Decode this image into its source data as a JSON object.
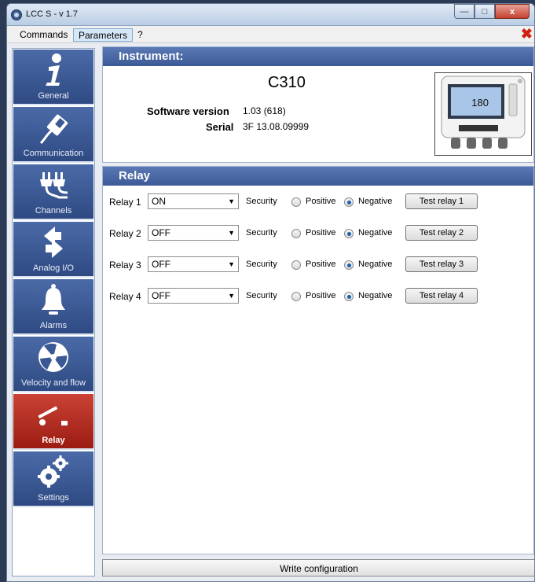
{
  "window": {
    "title": "LCC S - v 1.7",
    "minimize": "—",
    "maximize": "□",
    "close": "x"
  },
  "menubar": {
    "items": [
      "Commands",
      "Parameters",
      "?"
    ],
    "active_item": "Parameters",
    "close_glyph": "✖"
  },
  "sidebar": {
    "items": [
      {
        "label": "General",
        "icon": "info-icon"
      },
      {
        "label": "Communication",
        "icon": "ethernet-cable-icon"
      },
      {
        "label": "Channels",
        "icon": "plug-icon"
      },
      {
        "label": "Analog I/O",
        "icon": "arrows-io-icon"
      },
      {
        "label": "Alarms",
        "icon": "bell-icon"
      },
      {
        "label": "Velocity and flow",
        "icon": "fan-icon"
      },
      {
        "label": "Relay",
        "icon": "switch-icon"
      },
      {
        "label": "Settings",
        "icon": "gears-icon"
      }
    ],
    "selected": "Relay"
  },
  "instrument": {
    "heading": "Instrument:",
    "model": "C310",
    "software_version_label": "Software version",
    "software_version": "1.03 (618)",
    "serial_label": "Serial",
    "serial": "3F 13.08.09999",
    "device_display_value": "180"
  },
  "relay": {
    "heading": "Relay",
    "security_label": "Security",
    "positive_label": "Positive",
    "negative_label": "Negative",
    "rows": [
      {
        "label": "Relay 1",
        "state": "ON",
        "security": "Negative",
        "test_button": "Test relay 1"
      },
      {
        "label": "Relay 2",
        "state": "OFF",
        "security": "Negative",
        "test_button": "Test relay 2"
      },
      {
        "label": "Relay 3",
        "state": "OFF",
        "security": "Negative",
        "test_button": "Test relay 3"
      },
      {
        "label": "Relay 4",
        "state": "OFF",
        "security": "Negative",
        "test_button": "Test relay 4"
      }
    ]
  },
  "footer": {
    "write_button": "Write configuration"
  },
  "colors": {
    "nav_blue": "#3a5894",
    "nav_selected_red": "#b0281c",
    "panel_header_blue": "#4a69a5",
    "close_red": "#d02010"
  }
}
